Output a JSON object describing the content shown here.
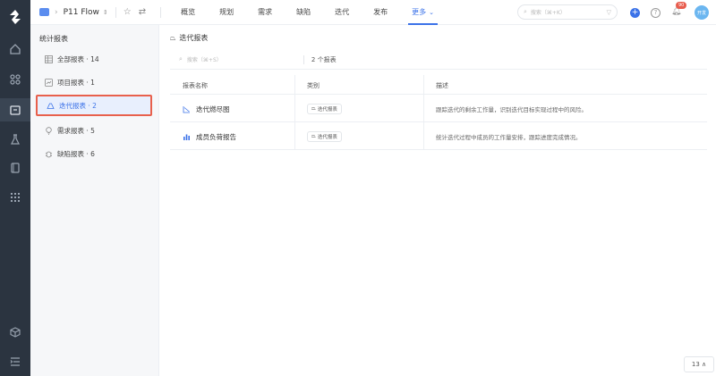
{
  "header": {
    "project_name": "P11 Flow",
    "nav_tabs": [
      {
        "label": "概览",
        "active": false
      },
      {
        "label": "规划",
        "active": false
      },
      {
        "label": "需求",
        "active": false
      },
      {
        "label": "缺陷",
        "active": false
      },
      {
        "label": "迭代",
        "active": false
      },
      {
        "label": "发布",
        "active": false
      },
      {
        "label": "更多",
        "active": true
      }
    ],
    "search_placeholder": "搜索（⌘+K）",
    "notification_count": "90",
    "avatar_text": "开发"
  },
  "sidebar": {
    "title": "统计报表",
    "items": [
      {
        "label": "全部报表 · 14",
        "icon": "grid-icon",
        "selected": false
      },
      {
        "label": "项目报表 · 1",
        "icon": "chart-icon",
        "selected": false
      },
      {
        "label": "迭代报表 · 2",
        "icon": "iteration-icon",
        "selected": true
      },
      {
        "label": "需求报表 · 5",
        "icon": "bulb-icon",
        "selected": false
      },
      {
        "label": "缺陷报表 · 6",
        "icon": "bug-icon",
        "selected": false
      }
    ]
  },
  "main": {
    "title": "迭代报表",
    "search_placeholder": "搜索（⌘+S）",
    "count_label": "2 个报表",
    "columns": [
      "报表名称",
      "类别",
      "描述"
    ],
    "rows": [
      {
        "name": "迭代燃尽图",
        "category": "迭代报表",
        "description": "跟踪迭代的剩余工作量，识别迭代目标实现过程中的风险。"
      },
      {
        "name": "成员负荷报告",
        "category": "迭代报表",
        "description": "统计迭代过程中成员的工作量安排，跟踪进度完成情况。"
      }
    ]
  },
  "pager": {
    "label": "13 ∧"
  },
  "colors": {
    "accent": "#3b72e8",
    "rail": "#2b3440",
    "highlight_border": "#e8604c"
  }
}
